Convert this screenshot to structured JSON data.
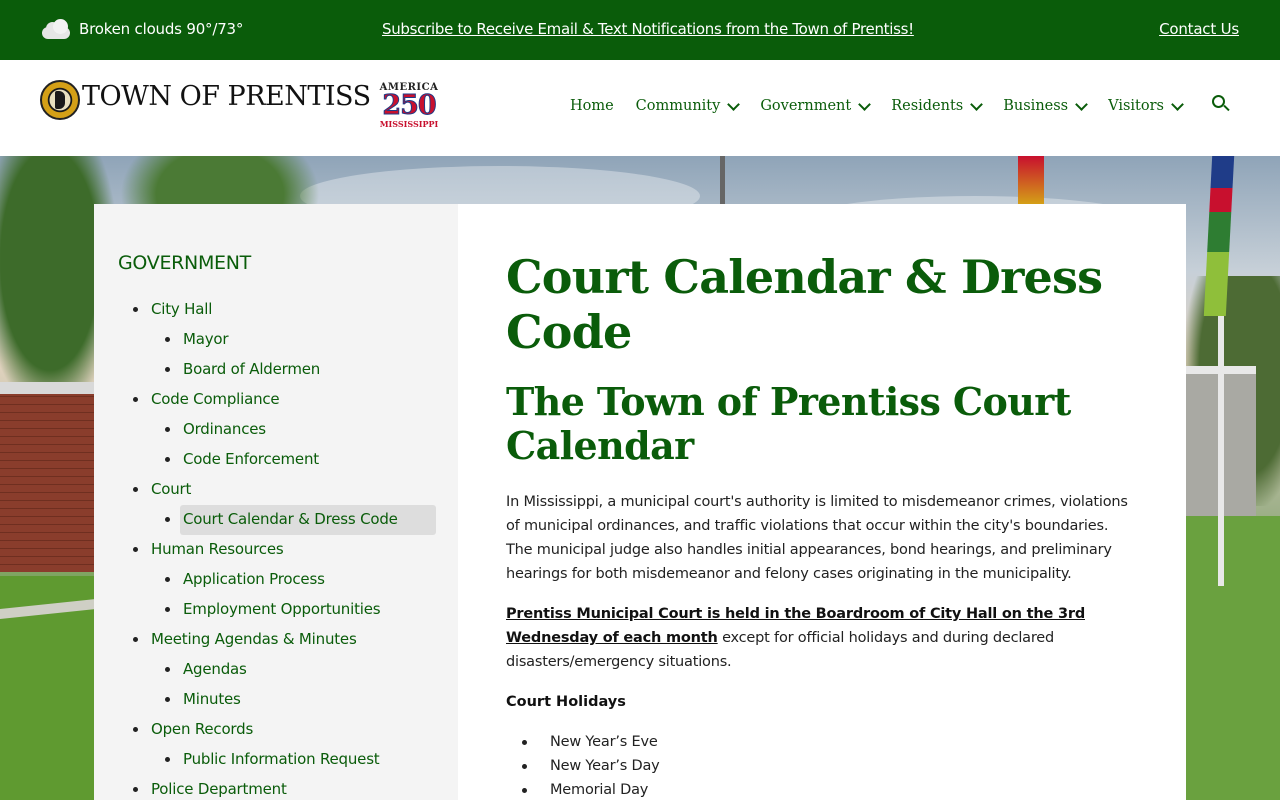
{
  "topbar": {
    "weather": "Broken clouds 90°/73°",
    "weather_icon": "cloud-icon",
    "subscribe": "Subscribe to Receive Email & Text Notifications from the Town of Prentiss!",
    "contact": "Contact Us",
    "bg_color": "#0a5c0a"
  },
  "header": {
    "site_name": "TOWN OF PRENTISS",
    "badge_top": "AMERICA",
    "badge_number": "250",
    "badge_bottom": "MISSISSIPPI",
    "nav": [
      {
        "label": "Home",
        "has_dropdown": false
      },
      {
        "label": "Community",
        "has_dropdown": true
      },
      {
        "label": "Government",
        "has_dropdown": true
      },
      {
        "label": "Residents",
        "has_dropdown": true
      },
      {
        "label": "Business",
        "has_dropdown": true
      },
      {
        "label": "Visitors",
        "has_dropdown": true
      }
    ]
  },
  "sidebar": {
    "title": "GOVERNMENT",
    "items": [
      {
        "label": "City Hall",
        "level": 1
      },
      {
        "label": "Mayor",
        "level": 2
      },
      {
        "label": "Board of Aldermen",
        "level": 2
      },
      {
        "label": "Code Compliance",
        "level": 1
      },
      {
        "label": "Ordinances",
        "level": 2
      },
      {
        "label": "Code Enforcement",
        "level": 2
      },
      {
        "label": "Court",
        "level": 1
      },
      {
        "label": "Court Calendar & Dress Code",
        "level": 2,
        "active": true
      },
      {
        "label": "Human Resources",
        "level": 1
      },
      {
        "label": "Application Process",
        "level": 2
      },
      {
        "label": "Employment Opportunities",
        "level": 2
      },
      {
        "label": "Meeting Agendas & Minutes",
        "level": 1
      },
      {
        "label": "Agendas",
        "level": 2
      },
      {
        "label": "Minutes",
        "level": 2
      },
      {
        "label": "Open Records",
        "level": 1
      },
      {
        "label": "Public Information Request",
        "level": 2
      },
      {
        "label": "Police Department",
        "level": 1
      }
    ]
  },
  "main": {
    "title": "Court Calendar & Dress Code",
    "subtitle": "The Town of Prentiss Court Calendar",
    "paragraph1": "In Mississippi, a municipal court's authority is limited to misdemeanor crimes, violations of municipal ordinances, and traffic violations that occur within the city's boundaries. The municipal judge also handles initial appearances, bond hearings, and preliminary hearings for both misdemeanor and felony cases originating in the municipality.",
    "paragraph2_link": "Prentiss Municipal Court is held in the Boardroom of City Hall on the 3rd Wednesday of each month",
    "paragraph2_rest": " except for official holidays and during declared disasters/emergency situations.",
    "holidays_heading": "Court Holidays",
    "holidays": [
      "New Year’s Eve",
      "New Year’s Day",
      "Memorial Day"
    ]
  }
}
